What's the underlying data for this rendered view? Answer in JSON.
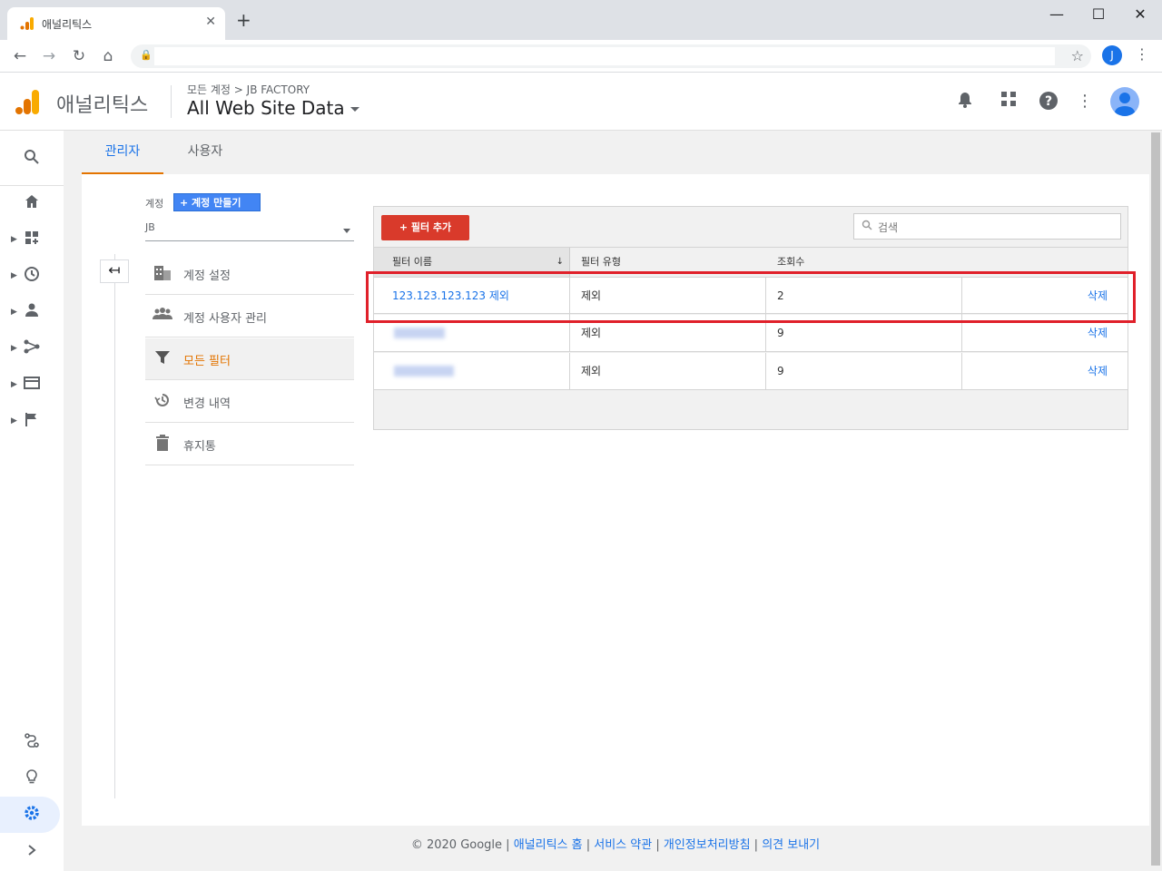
{
  "browser": {
    "tab_title": "애널리틱스",
    "tab_close": "✕",
    "new_tab": "+",
    "profile_initial": "J",
    "icons": [
      "back-icon",
      "forward-icon",
      "reload-icon",
      "home-icon",
      "lock-icon",
      "star-icon",
      "menu-icon"
    ]
  },
  "header": {
    "app_name": "애널리틱스",
    "breadcrumb": "모든 계정 > JB FACTORY",
    "property": "All Web Site Data"
  },
  "tabs": {
    "admin": "관리자",
    "user": "사용자"
  },
  "account": {
    "label": "계정",
    "create_button": "+ 계정 만들기",
    "selected": "JB"
  },
  "menu": [
    {
      "label": "계정 설정",
      "icon": "building-icon"
    },
    {
      "label": "계정 사용자 관리",
      "icon": "people-icon"
    },
    {
      "label": "모든 필터",
      "icon": "filter-icon"
    },
    {
      "label": "변경 내역",
      "icon": "history-icon"
    },
    {
      "label": "휴지통",
      "icon": "trash-icon"
    }
  ],
  "filters": {
    "add_button": "+ 필터 추가",
    "search_placeholder": "검색",
    "columns": [
      "필터 이름",
      "필터 유형",
      "조회수"
    ],
    "rows": [
      {
        "name": "123.123.123.123 제외",
        "type": "제외",
        "views": "2",
        "action": "삭제"
      },
      {
        "name": "",
        "type": "제외",
        "views": "9",
        "action": "삭제"
      },
      {
        "name": "",
        "type": "제외",
        "views": "9",
        "action": "삭제"
      }
    ]
  },
  "footer": {
    "copyright": "© 2020 Google",
    "sep": " | ",
    "links": [
      "애널리틱스 홈",
      "서비스 약관",
      "개인정보처리방침",
      "의견 보내기"
    ]
  },
  "colors": {
    "accent_blue": "#1a73e8",
    "ga_orange": "#e37400",
    "add_red": "#d93a2b",
    "highlight_red": "#e0202a"
  }
}
